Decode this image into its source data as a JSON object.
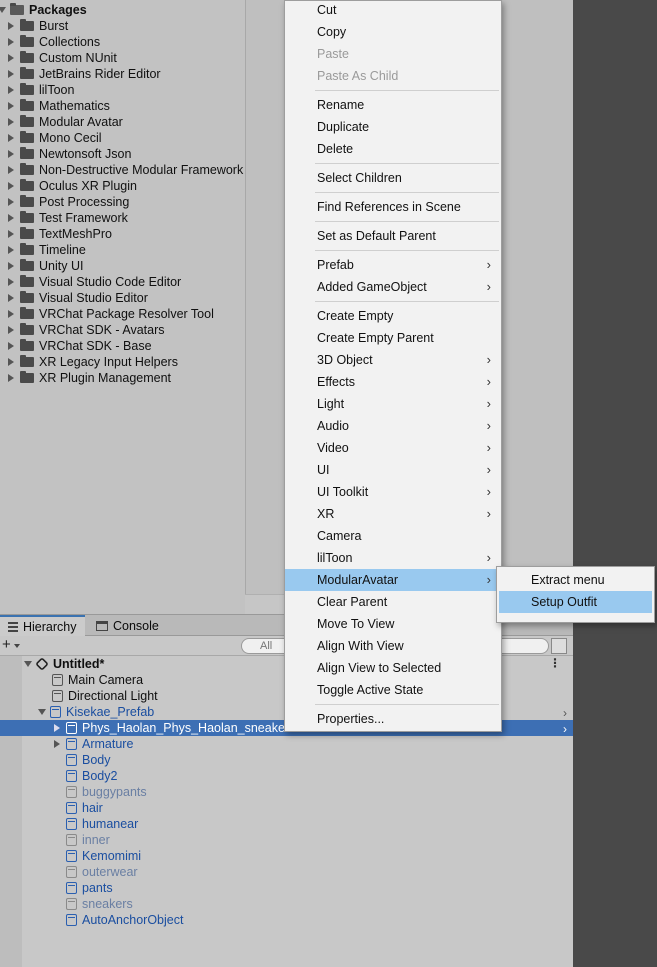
{
  "project": {
    "packages_header": "Packages",
    "packages": [
      "Burst",
      "Collections",
      "Custom NUnit",
      "JetBrains Rider Editor",
      "lilToon",
      "Mathematics",
      "Modular Avatar",
      "Mono Cecil",
      "Newtonsoft Json",
      "Non-Destructive Modular Framework",
      "Oculus XR Plugin",
      "Post Processing",
      "Test Framework",
      "TextMeshPro",
      "Timeline",
      "Unity UI",
      "Visual Studio Code Editor",
      "Visual Studio Editor",
      "VRChat Package Resolver Tool",
      "VRChat SDK - Avatars",
      "VRChat SDK - Base",
      "XR Legacy Input Helpers",
      "XR Plugin Management"
    ]
  },
  "tabs": {
    "hierarchy": "Hierarchy",
    "console": "Console"
  },
  "toolbar": {
    "add_symbol": "+",
    "search_placeholder": "All"
  },
  "hierarchy": {
    "scene_name": "Untitled*",
    "kebab_symbol": "⋮",
    "items": {
      "main_camera": "Main Camera",
      "directional_light": "Directional Light",
      "kisekae_prefab": "Kisekae_Prefab",
      "phys_object": "Phys_Haolan_Phys_Haolan_sneake",
      "armature": "Armature",
      "body": "Body",
      "body2": "Body2",
      "buggypants": "buggypants",
      "hair": "hair",
      "humanear": "humanear",
      "inner": "inner",
      "kemomimi": "Kemomimi",
      "outerwear": "outerwear",
      "pants": "pants",
      "sneakers": "sneakers",
      "auto_anchor": "AutoAnchorObject"
    }
  },
  "context_menu": {
    "cut": "Cut",
    "copy": "Copy",
    "paste": "Paste",
    "paste_as_child": "Paste As Child",
    "rename": "Rename",
    "duplicate": "Duplicate",
    "delete": "Delete",
    "select_children": "Select Children",
    "find_references": "Find References in Scene",
    "set_default_parent": "Set as Default Parent",
    "prefab": "Prefab",
    "added_gameobject": "Added GameObject",
    "create_empty": "Create Empty",
    "create_empty_parent": "Create Empty Parent",
    "object_3d": "3D Object",
    "effects": "Effects",
    "light": "Light",
    "audio": "Audio",
    "video": "Video",
    "ui": "UI",
    "ui_toolkit": "UI Toolkit",
    "xr": "XR",
    "camera": "Camera",
    "liltoon": "lilToon",
    "modular_avatar": "ModularAvatar",
    "clear_parent": "Clear Parent",
    "move_to_view": "Move To View",
    "align_with_view": "Align With View",
    "align_view_to_selected": "Align View to Selected",
    "toggle_active_state": "Toggle Active State",
    "properties": "Properties...",
    "submenu_arrow": "›"
  },
  "submenu": {
    "extract_menu": "Extract menu",
    "setup_outfit": "Setup Outfit"
  },
  "colors": {
    "selection_blue": "#3d6fb4",
    "menu_hover": "#99c9ef",
    "prefab_text": "#1a4ea0"
  }
}
